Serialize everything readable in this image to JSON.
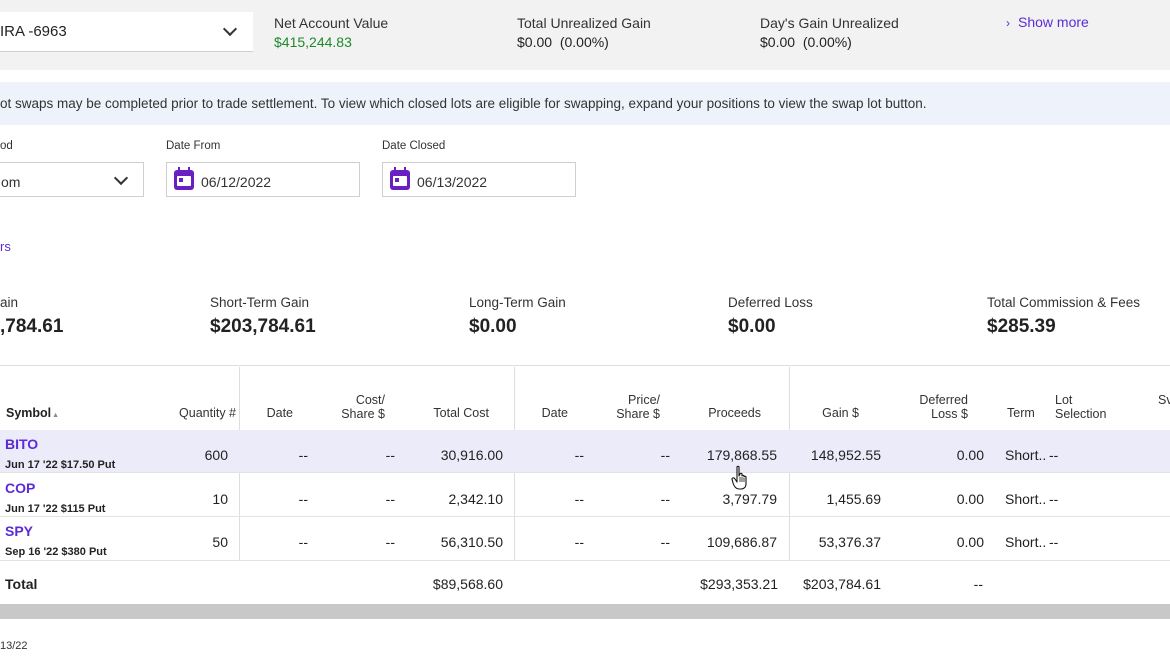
{
  "account": {
    "selected": "IRA -6963",
    "net_value_label": "Net Account Value",
    "net_value": "$415,244.83",
    "unrealized_label": "Total Unrealized Gain",
    "unrealized_value": "$0.00",
    "unrealized_pct": "(0.00%)",
    "days_gain_label": "Day's Gain Unrealized",
    "days_gain_value": "$0.00",
    "days_gain_pct": "(0.00%)",
    "show_more": "Show more"
  },
  "banner": {
    "text": "ot swaps may be completed prior to trade settlement. To view which closed lots are eligible for swapping, expand your positions to view the swap lot button."
  },
  "filters": {
    "period_label": "od",
    "period_value": "om",
    "date_from_label": "Date From",
    "date_from_value": "06/12/2022",
    "date_closed_label": "Date Closed",
    "date_closed_value": "06/13/2022",
    "link_text": "rs"
  },
  "summary": {
    "gain_label": "ain",
    "gain_value": ",784.61",
    "short_label": "Short-Term Gain",
    "short_value": "$203,784.61",
    "long_label": "Long-Term Gain",
    "long_value": "$0.00",
    "deferred_label": "Deferred Loss",
    "deferred_value": "$0.00",
    "comm_label": "Total Commission & Fees",
    "comm_value": "$285.39"
  },
  "table": {
    "headers": {
      "symbol": "Symbol",
      "sort_arrow": "▲",
      "quantity": "Quantity #",
      "open_date": "Date",
      "cost_share_1": "Cost/",
      "cost_share_2": "Share $",
      "total_cost": "Total Cost",
      "close_date": "Date",
      "price_share_1": "Price/",
      "price_share_2": "Share $",
      "proceeds": "Proceeds",
      "gain": "Gain $",
      "deferred_1": "Deferred",
      "deferred_2": "Loss $",
      "term": "Term",
      "lot_1": "Lot",
      "lot_2": "Selection",
      "swap_partial": "Sv"
    },
    "rows": [
      {
        "symbol": "BITO",
        "desc": "Jun 17 '22 $17.50 Put",
        "qty": "600",
        "open_date": "--",
        "cost_share": "--",
        "total_cost": "30,916.00",
        "close_date": "--",
        "price_share": "--",
        "proceeds": "179,868.55",
        "gain": "148,952.55",
        "deferred": "0.00",
        "term": "Short..",
        "lot": "--"
      },
      {
        "symbol": "COP",
        "desc": "Jun 17 '22 $115 Put",
        "qty": "10",
        "open_date": "--",
        "cost_share": "--",
        "total_cost": "2,342.10",
        "close_date": "--",
        "price_share": "--",
        "proceeds": "3,797.79",
        "gain": "1,455.69",
        "deferred": "0.00",
        "term": "Short..",
        "lot": "--"
      },
      {
        "symbol": "SPY",
        "desc": "Sep 16 '22 $380 Put",
        "qty": "50",
        "open_date": "--",
        "cost_share": "--",
        "total_cost": "56,310.50",
        "close_date": "--",
        "price_share": "--",
        "proceeds": "109,686.87",
        "gain": "53,376.37",
        "deferred": "0.00",
        "term": "Short..",
        "lot": "--"
      }
    ],
    "total": {
      "label": "Total",
      "total_cost": "$89,568.60",
      "proceeds": "$293,353.21",
      "gain": "$203,784.61",
      "deferred": "--"
    }
  },
  "footer": {
    "date_partial": "13/22"
  },
  "colors": {
    "accent": "#5b2bd6",
    "gain_green": "#1e8a2c",
    "selected_row": "#ecebfa"
  }
}
